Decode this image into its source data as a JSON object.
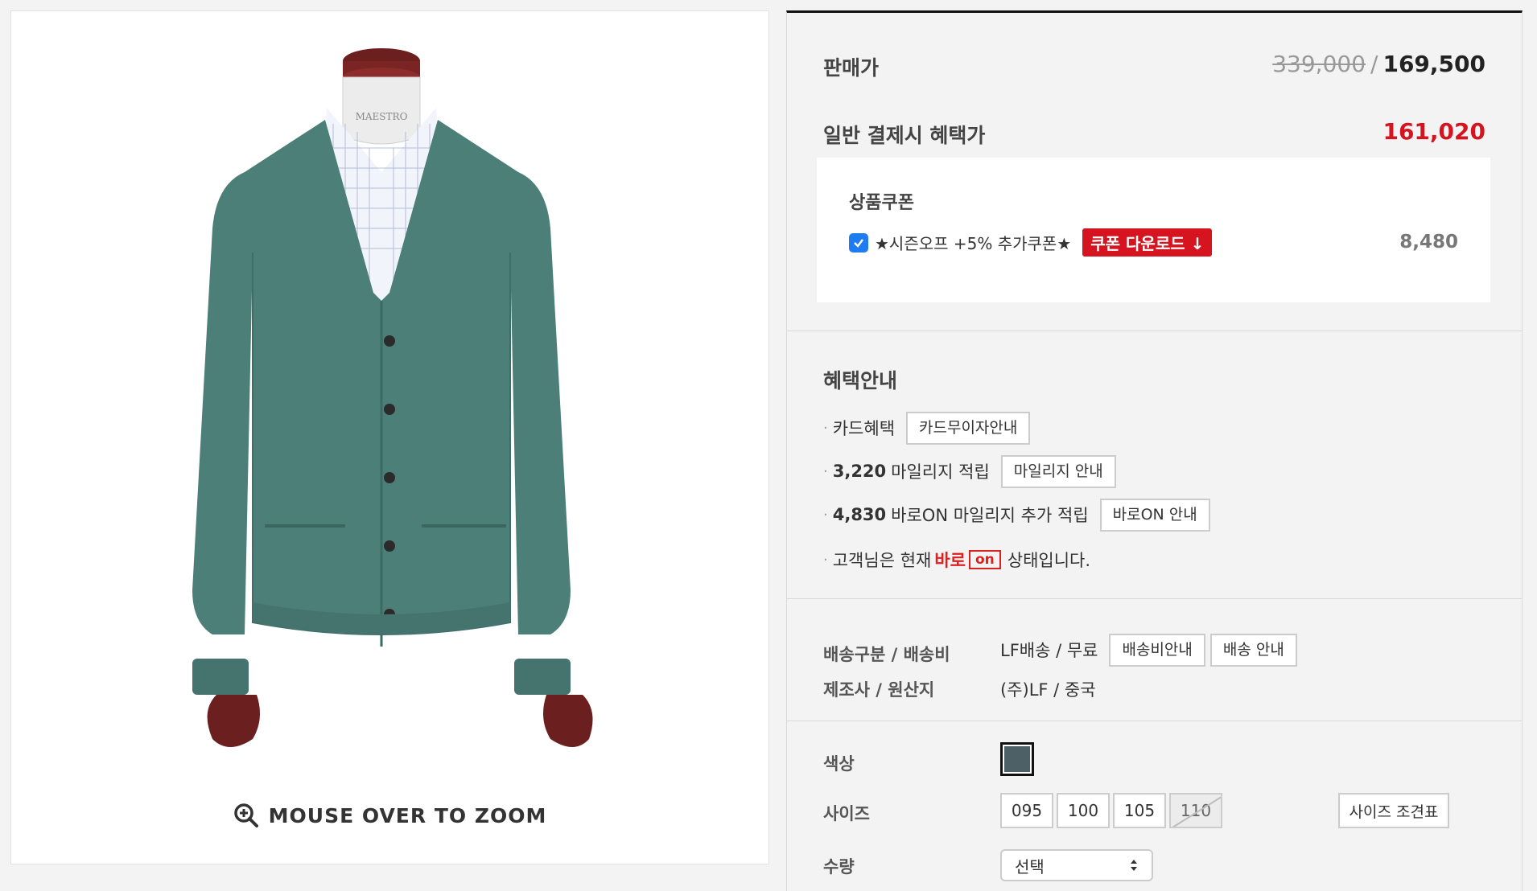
{
  "image_panel": {
    "zoom_hint": "MOUSE OVER TO ZOOM",
    "mannequin_logo": "MAESTRO"
  },
  "price": {
    "label": "판매가",
    "original": "339,000",
    "separator": "/",
    "sale": "169,500"
  },
  "benefit_price": {
    "label": "일반 결제시 혜택가",
    "value": "161,020"
  },
  "coupon": {
    "title": "상품쿠폰",
    "name": "★시즌오프 +5% 추가쿠폰★",
    "download_label": "쿠폰 다운로드 ↓",
    "amount": "8,480",
    "checked": true
  },
  "benefits": {
    "title": "혜택안내",
    "card_label": "카드혜택",
    "card_button": "카드무이자안내",
    "mileage_amount": "3,220",
    "mileage_text": "마일리지 적립",
    "mileage_button": "마일리지 안내",
    "baroon_amount": "4,830",
    "baroon_text": "바로ON 마일리지 추가 적립",
    "baroon_button": "바로ON 안내",
    "status_prefix": "고객님은 현재",
    "status_baro": "바로",
    "status_on": "on",
    "status_suffix": "상태입니다."
  },
  "shipping": {
    "label": "배송구분 / 배송비",
    "value": "LF배송 / 무료",
    "fee_button": "배송비안내",
    "info_button": "배송 안내",
    "maker_label": "제조사 / 원산지",
    "maker_value": "(주)LF / 중국"
  },
  "options": {
    "color_label": "색상",
    "color_value": "#4d6066",
    "size_label": "사이즈",
    "sizes": [
      {
        "label": "095",
        "soldout": false
      },
      {
        "label": "100",
        "soldout": false
      },
      {
        "label": "105",
        "soldout": false
      },
      {
        "label": "110",
        "soldout": true
      }
    ],
    "size_chart_button": "사이즈 조견표",
    "qty_label": "수량",
    "qty_placeholder": "선택"
  }
}
